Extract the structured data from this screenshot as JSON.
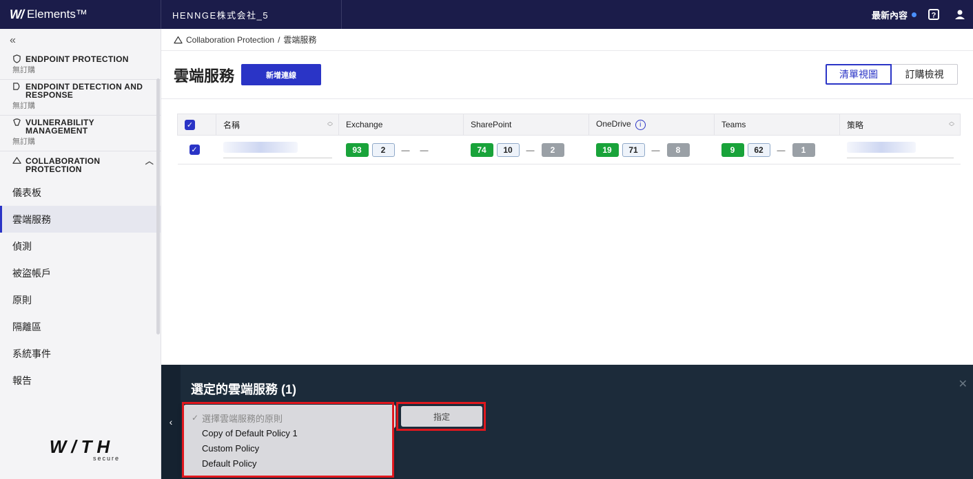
{
  "topbar": {
    "brand_logo": "W/",
    "brand_name": "Elements™",
    "org_name": "HENNGE株式会社_5",
    "whats_new": "最新內容",
    "accent_color": "#4a90ff"
  },
  "sidebar": {
    "collapse_glyph": "«",
    "groups": [
      {
        "title": "ENDPOINT PROTECTION",
        "sub": "無訂購"
      },
      {
        "title": "ENDPOINT DETECTION AND RESPONSE",
        "sub": "無訂購"
      },
      {
        "title": "VULNERABILITY MANAGEMENT",
        "sub": "無訂購"
      }
    ],
    "collab_title": "COLLABORATION PROTECTION",
    "items": [
      {
        "label": "儀表板"
      },
      {
        "label": "雲端服務"
      },
      {
        "label": "偵測"
      },
      {
        "label": "被盜帳戶"
      },
      {
        "label": "原則"
      },
      {
        "label": "隔離區"
      },
      {
        "label": "系統事件"
      },
      {
        "label": "報告"
      }
    ],
    "active_item": "雲端服務",
    "footer_logo": "W/TH",
    "footer_sub": "secure"
  },
  "main": {
    "breadcrumb": {
      "root": "Collaboration Protection",
      "sep": "/",
      "current": "雲端服務"
    },
    "title": "雲端服務",
    "add_button": "新增連線",
    "views": [
      "清單視圖",
      "訂購檢視"
    ],
    "active_view": "清單視圖",
    "table": {
      "headers": [
        "名稱",
        "Exchange",
        "SharePoint",
        "OneDrive",
        "Teams",
        "策略"
      ],
      "rows": [
        {
          "selected": true,
          "exchange": [
            "93",
            "2",
            "—",
            "—"
          ],
          "sharepoint": [
            "74",
            "10",
            "—",
            "2"
          ],
          "onedrive": [
            "19",
            "71",
            "—",
            "8"
          ],
          "teams": [
            "9",
            "62",
            "—",
            "1"
          ]
        }
      ]
    }
  },
  "bottom_panel": {
    "title": "選定的雲端服務 (1)",
    "assign_button": "指定",
    "dropdown": {
      "placeholder": "選擇雲端服務的原則",
      "options": [
        "Copy of Default Policy 1",
        "Custom Policy",
        "Default Policy"
      ]
    }
  }
}
